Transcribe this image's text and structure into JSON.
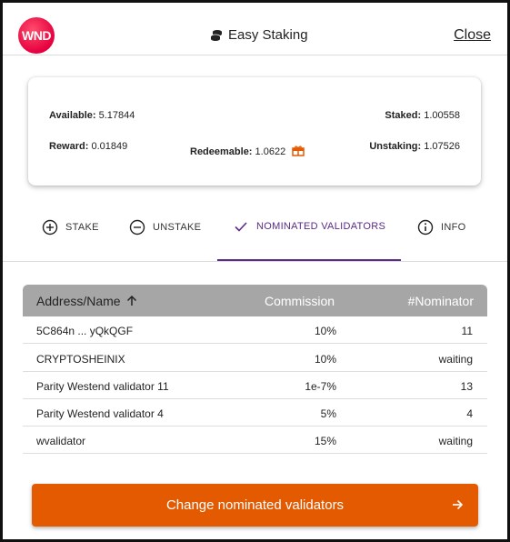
{
  "header": {
    "logo_text": "WND",
    "title": "Easy Staking",
    "close_label": "Close",
    "logo_color": "#e6003e"
  },
  "summary": {
    "available_label": "Available:",
    "available_value": "5.17844",
    "staked_label": "Staked:",
    "staked_value": "1.00558",
    "reward_label": "Reward:",
    "reward_value": "0.01849",
    "redeemable_label": "Redeemable:",
    "redeemable_value": "1.0622",
    "unstaking_label": "Unstaking:",
    "unstaking_value": "1.07526",
    "redeem_icon": "gift-icon",
    "accent_color": "#e45a00"
  },
  "tabs": [
    {
      "label": "STAKE",
      "icon": "plus-circle-icon",
      "active": false
    },
    {
      "label": "UNSTAKE",
      "icon": "minus-circle-icon",
      "active": false
    },
    {
      "label": "NOMINATED VALIDATORS",
      "icon": "check-icon",
      "active": true
    },
    {
      "label": "INFO",
      "icon": "info-circle-icon",
      "active": false
    }
  ],
  "table": {
    "columns": [
      "Address/Name",
      "Commission",
      "#Nominator"
    ],
    "sort_icon": "arrow-up-icon",
    "rows": [
      [
        "5C864n ... yQkQGF",
        "10%",
        "11"
      ],
      [
        "CRYPTOSHEINIX",
        "10%",
        "waiting"
      ],
      [
        "Parity Westend validator 11",
        "1e-7%",
        "13"
      ],
      [
        "Parity Westend validator 4",
        "5%",
        "4"
      ],
      [
        "wvalidator",
        "15%",
        "waiting"
      ]
    ]
  },
  "action": {
    "label": "Change nominated validators",
    "icon": "arrow-right-icon",
    "color": "#e45a00"
  }
}
